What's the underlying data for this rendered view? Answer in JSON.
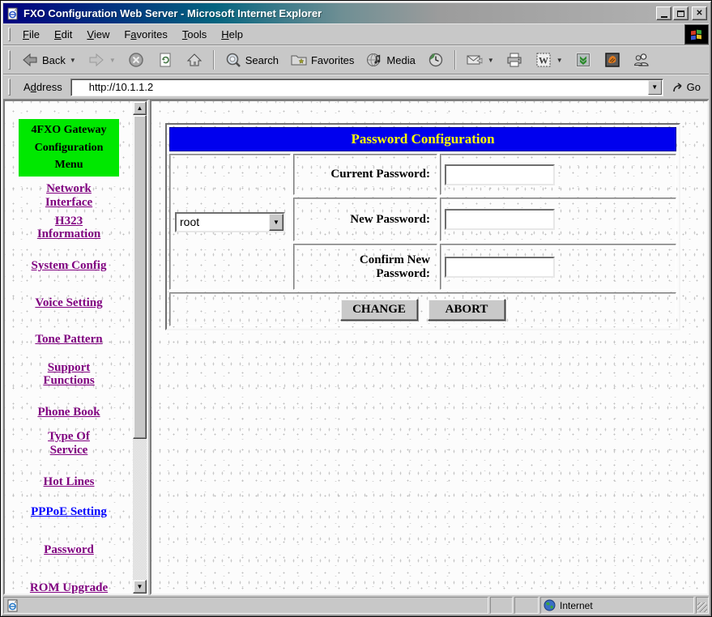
{
  "window": {
    "title": "FXO Configuration Web Server - Microsoft Internet Explorer",
    "controls": {
      "minimize": "minimize",
      "maximize": "maximize",
      "close": "X"
    }
  },
  "menu": {
    "items": [
      {
        "label": "File",
        "accel": 0
      },
      {
        "label": "Edit",
        "accel": 0
      },
      {
        "label": "View",
        "accel": 0
      },
      {
        "label": "Favorites",
        "accel": 1
      },
      {
        "label": "Tools",
        "accel": 0
      },
      {
        "label": "Help",
        "accel": 0
      }
    ]
  },
  "toolbar": {
    "back_label": "Back",
    "search_label": "Search",
    "favorites_label": "Favorites",
    "media_label": "Media",
    "icons": [
      "back-icon",
      "forward-icon",
      "stop-icon",
      "refresh-icon",
      "home-icon",
      "search-icon",
      "favorites-icon",
      "media-icon",
      "history-icon",
      "mail-icon",
      "print-icon",
      "edit-word-icon",
      "download-chevrons-icon",
      "messenger-icon",
      "discuss-icon"
    ]
  },
  "address": {
    "label": {
      "label": "Address",
      "accel": 1
    },
    "value": "http://10.1.1.2",
    "go_label": "Go"
  },
  "sidebar": {
    "header": "4FXO Gateway\nConfiguration\nMenu",
    "items": [
      {
        "label": "Network\nInterface"
      },
      {
        "label": "H323\nInformation"
      },
      {
        "label": "System Config"
      },
      {
        "label": "Voice Setting"
      },
      {
        "label": "Tone Pattern"
      },
      {
        "label": "Support\nFunctions"
      },
      {
        "label": "Phone Book"
      },
      {
        "label": "Type Of\nService"
      },
      {
        "label": "Hot Lines"
      },
      {
        "label": "PPPoE Setting"
      },
      {
        "label": "Password"
      },
      {
        "label": "ROM Upgrade"
      }
    ]
  },
  "main": {
    "title": "Password Configuration",
    "user_select": {
      "value": "root"
    },
    "rows": [
      {
        "label": "Current Password:",
        "value": ""
      },
      {
        "label": "New Password:",
        "value": ""
      },
      {
        "label": "Confirm New\nPassword:",
        "value": ""
      }
    ],
    "buttons": {
      "change": "CHANGE",
      "abort": "ABORT"
    }
  },
  "status": {
    "zone": "Internet"
  },
  "colors": {
    "title_gradient_start": "#000080",
    "title_gradient_mid": "#04647f",
    "title_gradient_end": "#b4b4b4",
    "chrome": "#c8c8c8",
    "menu_header_bg": "#00e800",
    "page_header_bg": "#0000ee",
    "page_header_text": "#ffff00",
    "link_visited": "#800080",
    "link_unvisited": "#0000ff"
  }
}
